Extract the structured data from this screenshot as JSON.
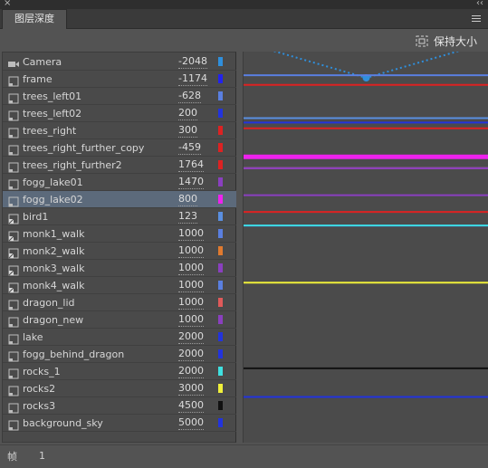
{
  "window": {
    "close_glyph": "×",
    "collapse_glyph": "‹‹"
  },
  "tab": {
    "label": "图层深度"
  },
  "toolbar": {
    "maintain_size_label": "保持大小"
  },
  "layers": [
    {
      "name": "Camera",
      "depth": "-2048",
      "swatch": "#2f8fdc",
      "icon": "camera-icon"
    },
    {
      "name": "frame",
      "depth": "-1174",
      "swatch": "#2222ee",
      "icon": "layer-icon"
    },
    {
      "name": "trees_left01",
      "depth": "-628",
      "swatch": "#5a7fe0",
      "icon": "layer-icon"
    },
    {
      "name": "trees_left02",
      "depth": "200",
      "swatch": "#2233dd",
      "icon": "layer-icon"
    },
    {
      "name": "trees_right",
      "depth": "300",
      "swatch": "#dd2222",
      "icon": "layer-icon"
    },
    {
      "name": "trees_right_further_copy",
      "depth": "-459",
      "swatch": "#dd2222",
      "icon": "layer-icon"
    },
    {
      "name": "trees_right_further2",
      "depth": "1764",
      "swatch": "#dd2222",
      "icon": "layer-icon"
    },
    {
      "name": "fogg_lake01",
      "depth": "1470",
      "swatch": "#8a3fbf",
      "icon": "layer-icon"
    },
    {
      "name": "fogg_lake02",
      "depth": "800",
      "swatch": "#ee22ee",
      "icon": "layer-icon"
    },
    {
      "name": "bird1",
      "depth": "123",
      "swatch": "#5a8fe0",
      "icon": "movieclip-icon"
    },
    {
      "name": "monk1_walk",
      "depth": "1000",
      "swatch": "#5a7fe0",
      "icon": "movieclip-icon"
    },
    {
      "name": "monk2_walk",
      "depth": "1000",
      "swatch": "#e07a2f",
      "icon": "movieclip-icon"
    },
    {
      "name": "monk3_walk",
      "depth": "1000",
      "swatch": "#8a3fbf",
      "icon": "movieclip-icon"
    },
    {
      "name": "monk4_walk",
      "depth": "1000",
      "swatch": "#5a7fe0",
      "icon": "movieclip-icon"
    },
    {
      "name": "dragon_lid",
      "depth": "1000",
      "swatch": "#e05a5a",
      "icon": "layer-icon"
    },
    {
      "name": "dragon_new",
      "depth": "1000",
      "swatch": "#8a3fbf",
      "icon": "layer-icon"
    },
    {
      "name": "lake",
      "depth": "2000",
      "swatch": "#2233dd",
      "icon": "layer-icon"
    },
    {
      "name": "fogg_behind_dragon",
      "depth": "2000",
      "swatch": "#2233dd",
      "icon": "layer-icon"
    },
    {
      "name": "rocks_1",
      "depth": "2000",
      "swatch": "#3fe0e0",
      "icon": "layer-icon"
    },
    {
      "name": "rocks2",
      "depth": "3000",
      "swatch": "#f0f03a",
      "icon": "layer-icon"
    },
    {
      "name": "rocks3",
      "depth": "4500",
      "swatch": "#111111",
      "icon": "layer-icon"
    },
    {
      "name": "background_sky",
      "depth": "5000",
      "swatch": "#2233dd",
      "icon": "layer-icon"
    }
  ],
  "selected_layer": "fogg_lake02",
  "footer": {
    "frame_label": "帧",
    "frame_value": "1"
  }
}
